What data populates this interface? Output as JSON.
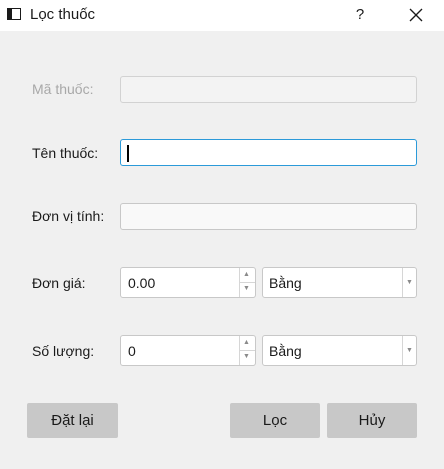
{
  "window": {
    "title": "Lọc thuốc",
    "help_label": "?"
  },
  "form": {
    "ma_thuoc": {
      "label": "Mã thuốc:",
      "value": ""
    },
    "ten_thuoc": {
      "label": "Tên thuốc:",
      "value": ""
    },
    "don_vi_tinh": {
      "label": "Đơn vị tính:",
      "value": ""
    },
    "don_gia": {
      "label": "Đơn giá:",
      "value": "0.00",
      "comparator": "Bằng"
    },
    "so_luong": {
      "label": "Số lượng:",
      "value": "0",
      "comparator": "Bằng"
    }
  },
  "buttons": {
    "reset": "Đặt lại",
    "filter": "Lọc",
    "cancel": "Hủy"
  },
  "icons": {
    "app": "window-app-icon",
    "help": "help-icon",
    "close": "close-icon",
    "spin_up": "chevron-up-icon",
    "spin_down": "chevron-down-icon",
    "dropdown": "chevron-down-icon"
  }
}
